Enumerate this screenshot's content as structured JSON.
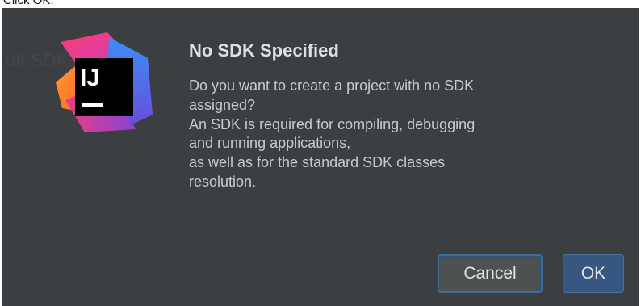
{
  "instruction": "Click OK.",
  "background_ghost": "ult SDK  Proje",
  "dialog": {
    "title": "No SDK Specified",
    "message_lines": [
      "Do you want to create a project with no SDK",
      "assigned?",
      "An SDK is required for compiling, debugging",
      "and running applications,",
      "as well as for the standard SDK classes",
      "resolution."
    ],
    "logo_text": "IJ",
    "buttons": {
      "cancel_label": "Cancel",
      "ok_label": "OK"
    }
  },
  "colors": {
    "dialog_bg": "#3c3f41",
    "title_text": "#e0e0e0",
    "body_text": "#c9c9c9",
    "button_bg": "#4d5152",
    "ok_button_bg": "#365880",
    "focus_ring": "#3f6d96"
  },
  "icons": {
    "app_logo": "intellij-idea-logo-icon"
  }
}
